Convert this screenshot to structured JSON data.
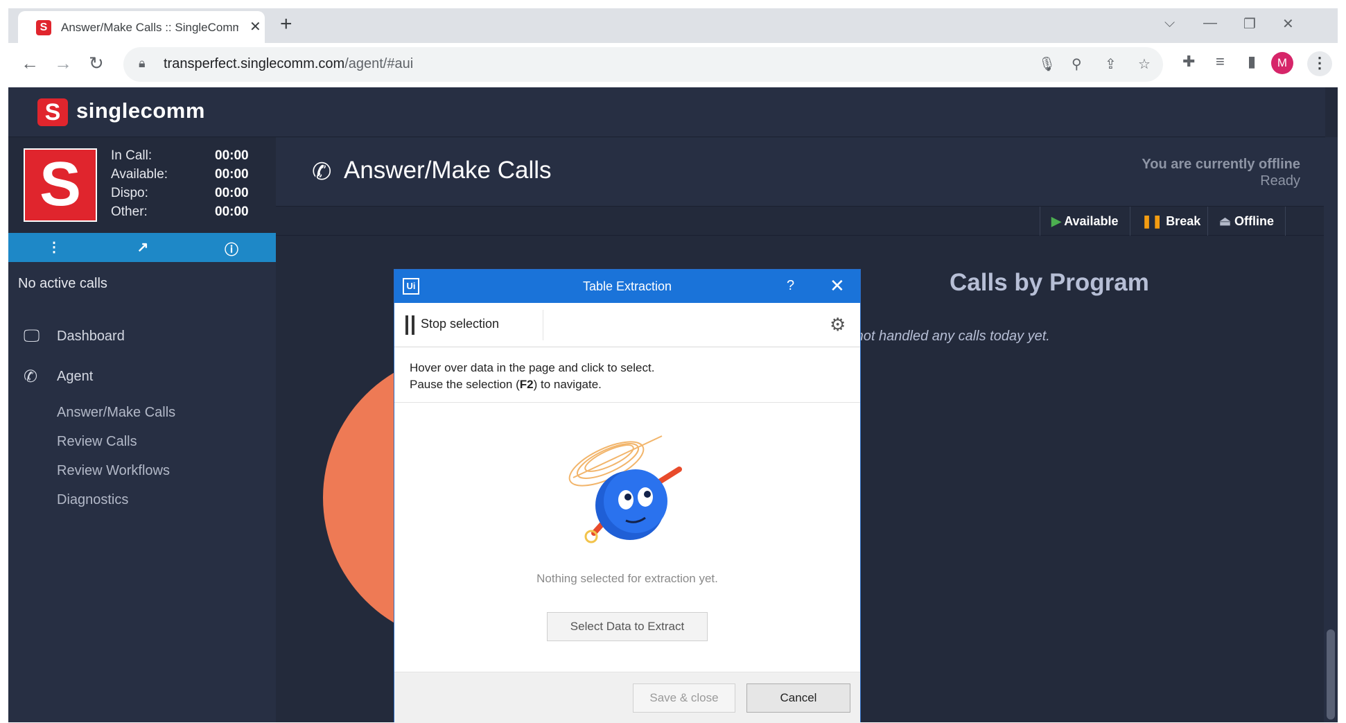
{
  "browser": {
    "tab_title": "Answer/Make Calls :: SingleComm",
    "tab_close": "✕",
    "new_tab": "+",
    "url_host": "transperfect.singlecomm.com",
    "url_path": "/agent/#aui",
    "profile_initial": "M"
  },
  "app": {
    "logo_letter": "S",
    "logo_text": "singlecomm"
  },
  "agent": {
    "timers": [
      {
        "label": "In Call:",
        "value": "00:00"
      },
      {
        "label": "Available:",
        "value": "00:00"
      },
      {
        "label": "Dispo:",
        "value": "00:00"
      },
      {
        "label": "Other:",
        "value": "00:00"
      }
    ],
    "no_calls": "No active calls"
  },
  "sidebar": {
    "nav": [
      {
        "label": "Dashboard",
        "icon": "monitor-icon"
      },
      {
        "label": "Agent",
        "icon": "phone-icon"
      }
    ],
    "sub_items": [
      {
        "label": "Answer/Make Calls"
      },
      {
        "label": "Review Calls"
      },
      {
        "label": "Review Workflows"
      },
      {
        "label": "Diagnostics"
      }
    ]
  },
  "main": {
    "title": "Answer/Make Calls",
    "offline_msg": "You are currently offline",
    "ready_msg": "Ready",
    "status_buttons": [
      {
        "label": "Available",
        "icon": "play-icon"
      },
      {
        "label": "Break",
        "icon": "pause-icon"
      },
      {
        "label": "Offline",
        "icon": "eject-icon"
      }
    ],
    "chart_title": "Calls by Program",
    "chart_empty": "e not handled any calls today yet."
  },
  "dialog": {
    "logo": "Ui",
    "title": "Table Extraction",
    "help": "?",
    "close": "✕",
    "stop_selection": "Stop selection",
    "instr_line1": "Hover over data in the page and click to select.",
    "instr_line2_pre": "Pause the selection (",
    "instr_key": "F2",
    "instr_line2_post": ") to navigate.",
    "empty_msg": "Nothing selected for extraction yet.",
    "select_btn": "Select Data to Extract",
    "save_btn": "Save & close",
    "cancel_btn": "Cancel"
  },
  "colors": {
    "app_bg": "#232a3b",
    "accent_blue": "#1e88c7",
    "brand_red": "#e0252d",
    "dialog_blue": "#1a73d9",
    "pie_orange": "#ee7a55"
  }
}
